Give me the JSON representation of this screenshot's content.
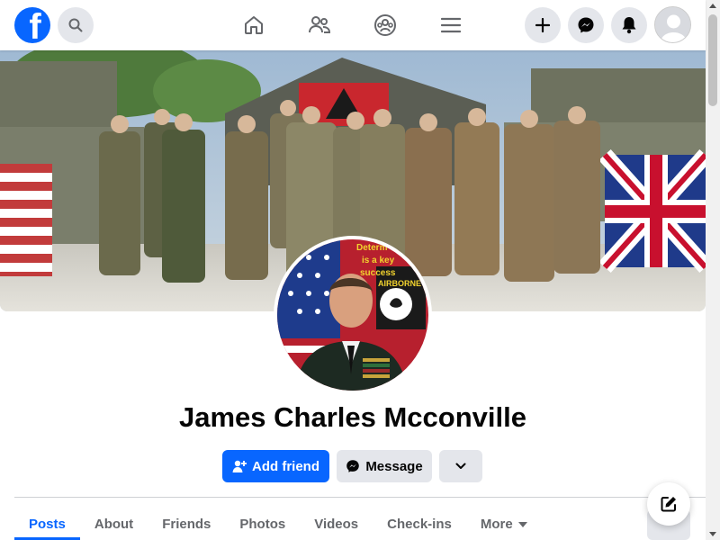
{
  "app": {
    "brand_letter": "f",
    "accent": "#0866ff"
  },
  "topbar": {
    "icons": [
      "search-icon",
      "home-icon",
      "friends-icon",
      "groups-icon",
      "menu-icon",
      "plus-icon",
      "messenger-icon",
      "bell-icon"
    ]
  },
  "profile": {
    "name": "James Charles Mcconville",
    "photo_text_line1": "Determ",
    "photo_text_line2": "is a key",
    "photo_text_line3": "success",
    "photo_badge_text": "AIRBORNE"
  },
  "actions": {
    "add_friend_label": "Add friend",
    "message_label": "Message"
  },
  "tabs": [
    {
      "label": "Posts",
      "active": true
    },
    {
      "label": "About",
      "active": false
    },
    {
      "label": "Friends",
      "active": false
    },
    {
      "label": "Photos",
      "active": false
    },
    {
      "label": "Videos",
      "active": false
    },
    {
      "label": "Check-ins",
      "active": false
    },
    {
      "label": "More",
      "active": false
    }
  ]
}
